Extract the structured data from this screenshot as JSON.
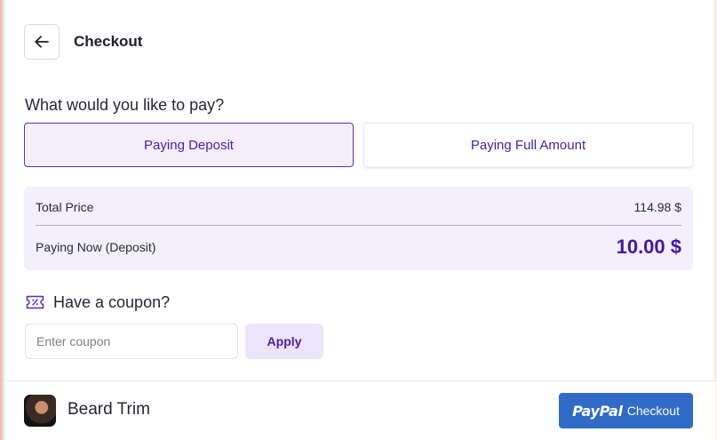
{
  "header": {
    "title": "Checkout",
    "back_icon": "arrow-left-icon"
  },
  "payment": {
    "question": "What would you like to pay?",
    "options": [
      {
        "label": "Paying Deposit",
        "selected": true
      },
      {
        "label": "Paying Full Amount",
        "selected": false
      }
    ]
  },
  "summary": {
    "total_label": "Total Price",
    "total_value": "114.98 $",
    "now_label": "Paying Now (Deposit)",
    "now_value": "10.00 $"
  },
  "coupon": {
    "heading": "Have a coupon?",
    "icon": "coupon-icon",
    "placeholder": "Enter coupon",
    "value": "",
    "apply_label": "Apply"
  },
  "footer": {
    "service_name": "Beard Trim",
    "paypal_logo": "PayPal",
    "paypal_label": "Checkout"
  },
  "colors": {
    "accent": "#4b1fa0",
    "selected_bg": "#f3edfc",
    "summary_bg": "#f3effc",
    "paypal_blue": "#2f6bc7"
  }
}
